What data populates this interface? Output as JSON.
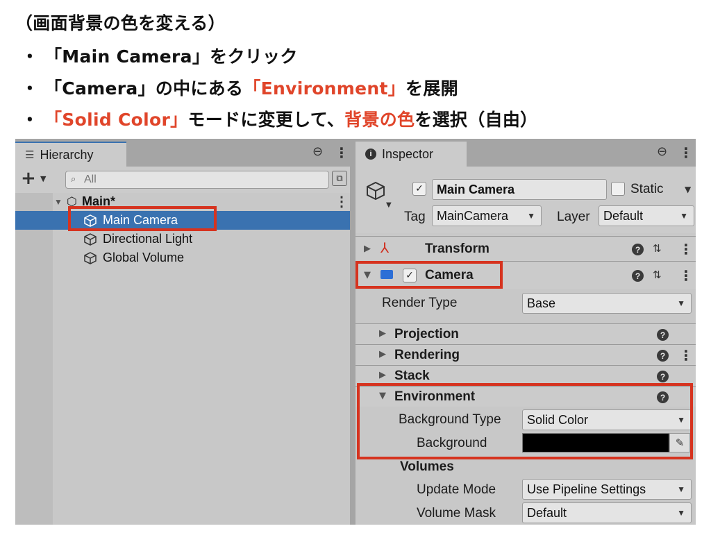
{
  "instructions": {
    "line1": "（画面背景の色を変える）",
    "bullet": "・",
    "line2": "「Main Camera」をクリック",
    "line3_prefix": "「Camera」の中にある",
    "line3_red": "「Environment」",
    "line3_suffix": "を展開",
    "line4_red1": "「Solid Color」",
    "line4_mid": "モードに変更して、",
    "line4_red2": "背景の色",
    "line4_suffix": "を選択（自由）",
    "accent_color": "#e0452a"
  },
  "hierarchy": {
    "tab_label": "Hierarchy",
    "search_placeholder": "All",
    "scene_name": "Main*",
    "items": [
      {
        "label": "Main Camera",
        "selected": true
      },
      {
        "label": "Directional Light",
        "selected": false
      },
      {
        "label": "Global Volume",
        "selected": false
      }
    ],
    "selection_color": "#3a72b0"
  },
  "inspector": {
    "tab_label": "Inspector",
    "object_name": "Main Camera",
    "object_enabled": true,
    "static_label": "Static",
    "tag_label": "Tag",
    "tag_value": "MainCamera",
    "layer_label": "Layer",
    "layer_value": "Default",
    "components": {
      "transform": "Transform",
      "camera": "Camera"
    },
    "camera": {
      "render_type_label": "Render Type",
      "render_type_value": "Base",
      "projection": "Projection",
      "rendering": "Rendering",
      "stack": "Stack",
      "environment": "Environment",
      "background_type_label": "Background Type",
      "background_type_value": "Solid Color",
      "background_label": "Background",
      "background_color": "#000000",
      "volumes": "Volumes",
      "update_mode_label": "Update Mode",
      "update_mode_value": "Use Pipeline Settings",
      "volume_mask_label": "Volume Mask",
      "volume_mask_value": "Default"
    }
  },
  "highlight_color": "#d6331f"
}
